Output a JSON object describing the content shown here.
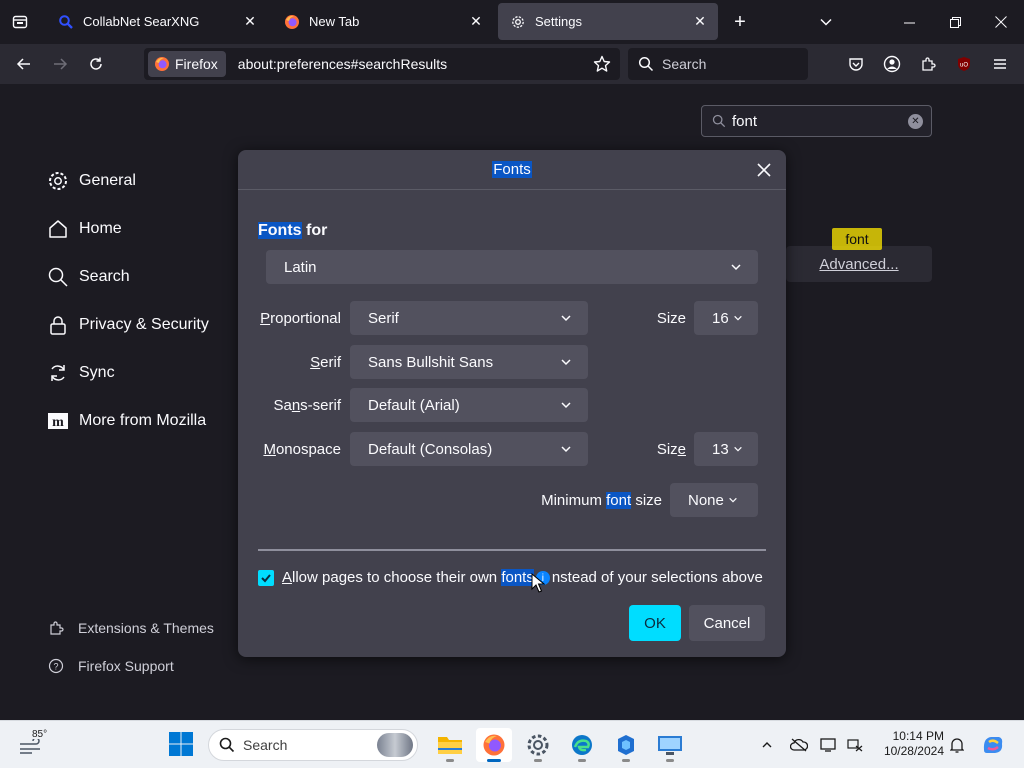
{
  "tabs": [
    {
      "label": "CollabNet SearXNG",
      "icon": "searxng-icon",
      "active": false
    },
    {
      "label": "New Tab",
      "icon": "firefox-icon",
      "active": false
    },
    {
      "label": "Settings",
      "icon": "gear-icon",
      "active": true
    }
  ],
  "navbar": {
    "identity_label": "Firefox",
    "url": "about:preferences#searchResults",
    "search_placeholder": "Search"
  },
  "find": {
    "value": "font"
  },
  "sidebar": {
    "items": [
      {
        "label": "General",
        "icon": "gear-icon"
      },
      {
        "label": "Home",
        "icon": "home-icon"
      },
      {
        "label": "Search",
        "icon": "search-icon"
      },
      {
        "label": "Privacy & Security",
        "icon": "lock-icon"
      },
      {
        "label": "Sync",
        "icon": "sync-icon"
      },
      {
        "label": "More from Mozilla",
        "icon": "mozilla-icon"
      }
    ],
    "footer": [
      {
        "label": "Extensions & Themes",
        "icon": "puzzle-icon"
      },
      {
        "label": "Firefox Support",
        "icon": "help-icon"
      }
    ]
  },
  "advanced": {
    "tooltip": "font",
    "label": "Advanced..."
  },
  "dialog": {
    "title": "Fonts",
    "heading_hl": "Fonts",
    "heading_rest": " for",
    "language": "Latin",
    "rows": {
      "proportional": {
        "label_u": "P",
        "label_rest": "roportional",
        "value": "Serif",
        "size_label_pre": "Size",
        "size_value": "16"
      },
      "serif": {
        "label_pre": "",
        "label_u": "S",
        "label_rest": "erif",
        "value": "Sans Bullshit Sans"
      },
      "sans_serif": {
        "label_pre": "Sa",
        "label_u": "n",
        "label_rest": "s-serif",
        "value": "Default (Arial)"
      },
      "monospace": {
        "label_u": "M",
        "label_rest": "onospace",
        "value": "Default (Consolas)",
        "size_label_pre": "Siz",
        "size_label_u": "e",
        "size_value": "13"
      }
    },
    "min_size": {
      "pre": "Minimum ",
      "hl": "font",
      "post": " size",
      "value": "None"
    },
    "allow": {
      "u": "A",
      "pre": "llow pages to choose their own ",
      "hl": "fonts",
      "post": "nstead of your selections above",
      "checked": true
    },
    "ok": "OK",
    "cancel": "Cancel"
  },
  "taskbar": {
    "weather_temp": "85°",
    "search_placeholder": "Search",
    "time": "10:14 PM",
    "date": "10/28/2024"
  },
  "colors": {
    "accent": "#00ddff",
    "highlight": "#0a56c4",
    "dialog_bg": "#42414d"
  }
}
